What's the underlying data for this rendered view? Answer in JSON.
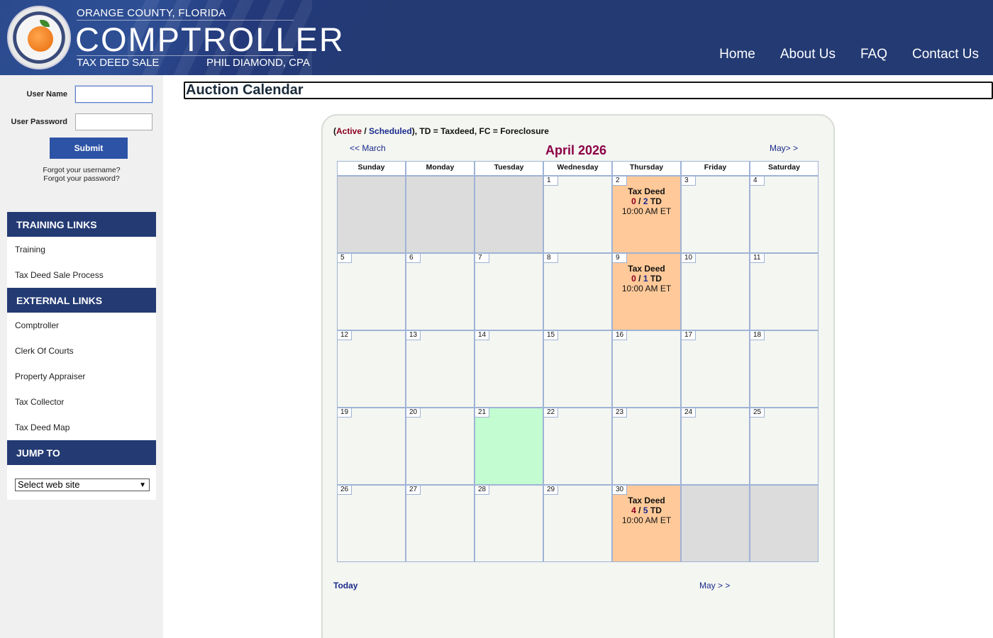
{
  "header": {
    "county": "ORANGE COUNTY, FLORIDA",
    "title": "COMPTROLLER",
    "sub_left": "TAX DEED SALE",
    "sub_right": "PHIL DIAMOND, CPA",
    "nav": [
      "Home",
      "About Us",
      "FAQ",
      "Contact Us"
    ]
  },
  "login": {
    "username_label": "User Name",
    "username_value": "",
    "password_label": "User Password",
    "password_value": "",
    "submit_label": "Submit",
    "forgot_username": "Forgot your username?",
    "forgot_password": "Forgot your password?"
  },
  "sidebar": {
    "training_head": "TRAINING LINKS",
    "training_items": [
      "Training",
      "Tax Deed Sale Process"
    ],
    "external_head": "EXTERNAL LINKS",
    "external_items": [
      "Comptroller",
      "Clerk Of Courts",
      "Property Appraiser",
      "Tax Collector",
      "Tax Deed Map"
    ],
    "jump_head": "JUMP TO",
    "jump_selected": "Select web site"
  },
  "main": {
    "title": "Auction Calendar",
    "legend": {
      "open": "(",
      "active": "Active",
      "slash": " / ",
      "scheduled": "Scheduled",
      "rest": "), TD = Taxdeed, FC = Foreclosure"
    },
    "prev_label": "<< March",
    "next_label": "May> >",
    "month_title": "April 2026",
    "today_label": "Today",
    "bottom_next_label": "May > >",
    "days_of_week": [
      "Sunday",
      "Monday",
      "Tuesday",
      "Wednesday",
      "Thursday",
      "Friday",
      "Saturday"
    ]
  },
  "calendar": {
    "first_weekday": 3,
    "days_in_month": 30,
    "today": 21,
    "events": {
      "2": {
        "title": "Tax Deed",
        "active": "0",
        "scheduled": "2",
        "type": "TD",
        "time": "10:00 AM ET"
      },
      "9": {
        "title": "Tax Deed",
        "active": "0",
        "scheduled": "1",
        "type": "TD",
        "time": "10:00 AM ET"
      },
      "30": {
        "title": "Tax Deed",
        "active": "4",
        "scheduled": "5",
        "type": "TD",
        "time": "10:00 AM ET"
      }
    }
  }
}
